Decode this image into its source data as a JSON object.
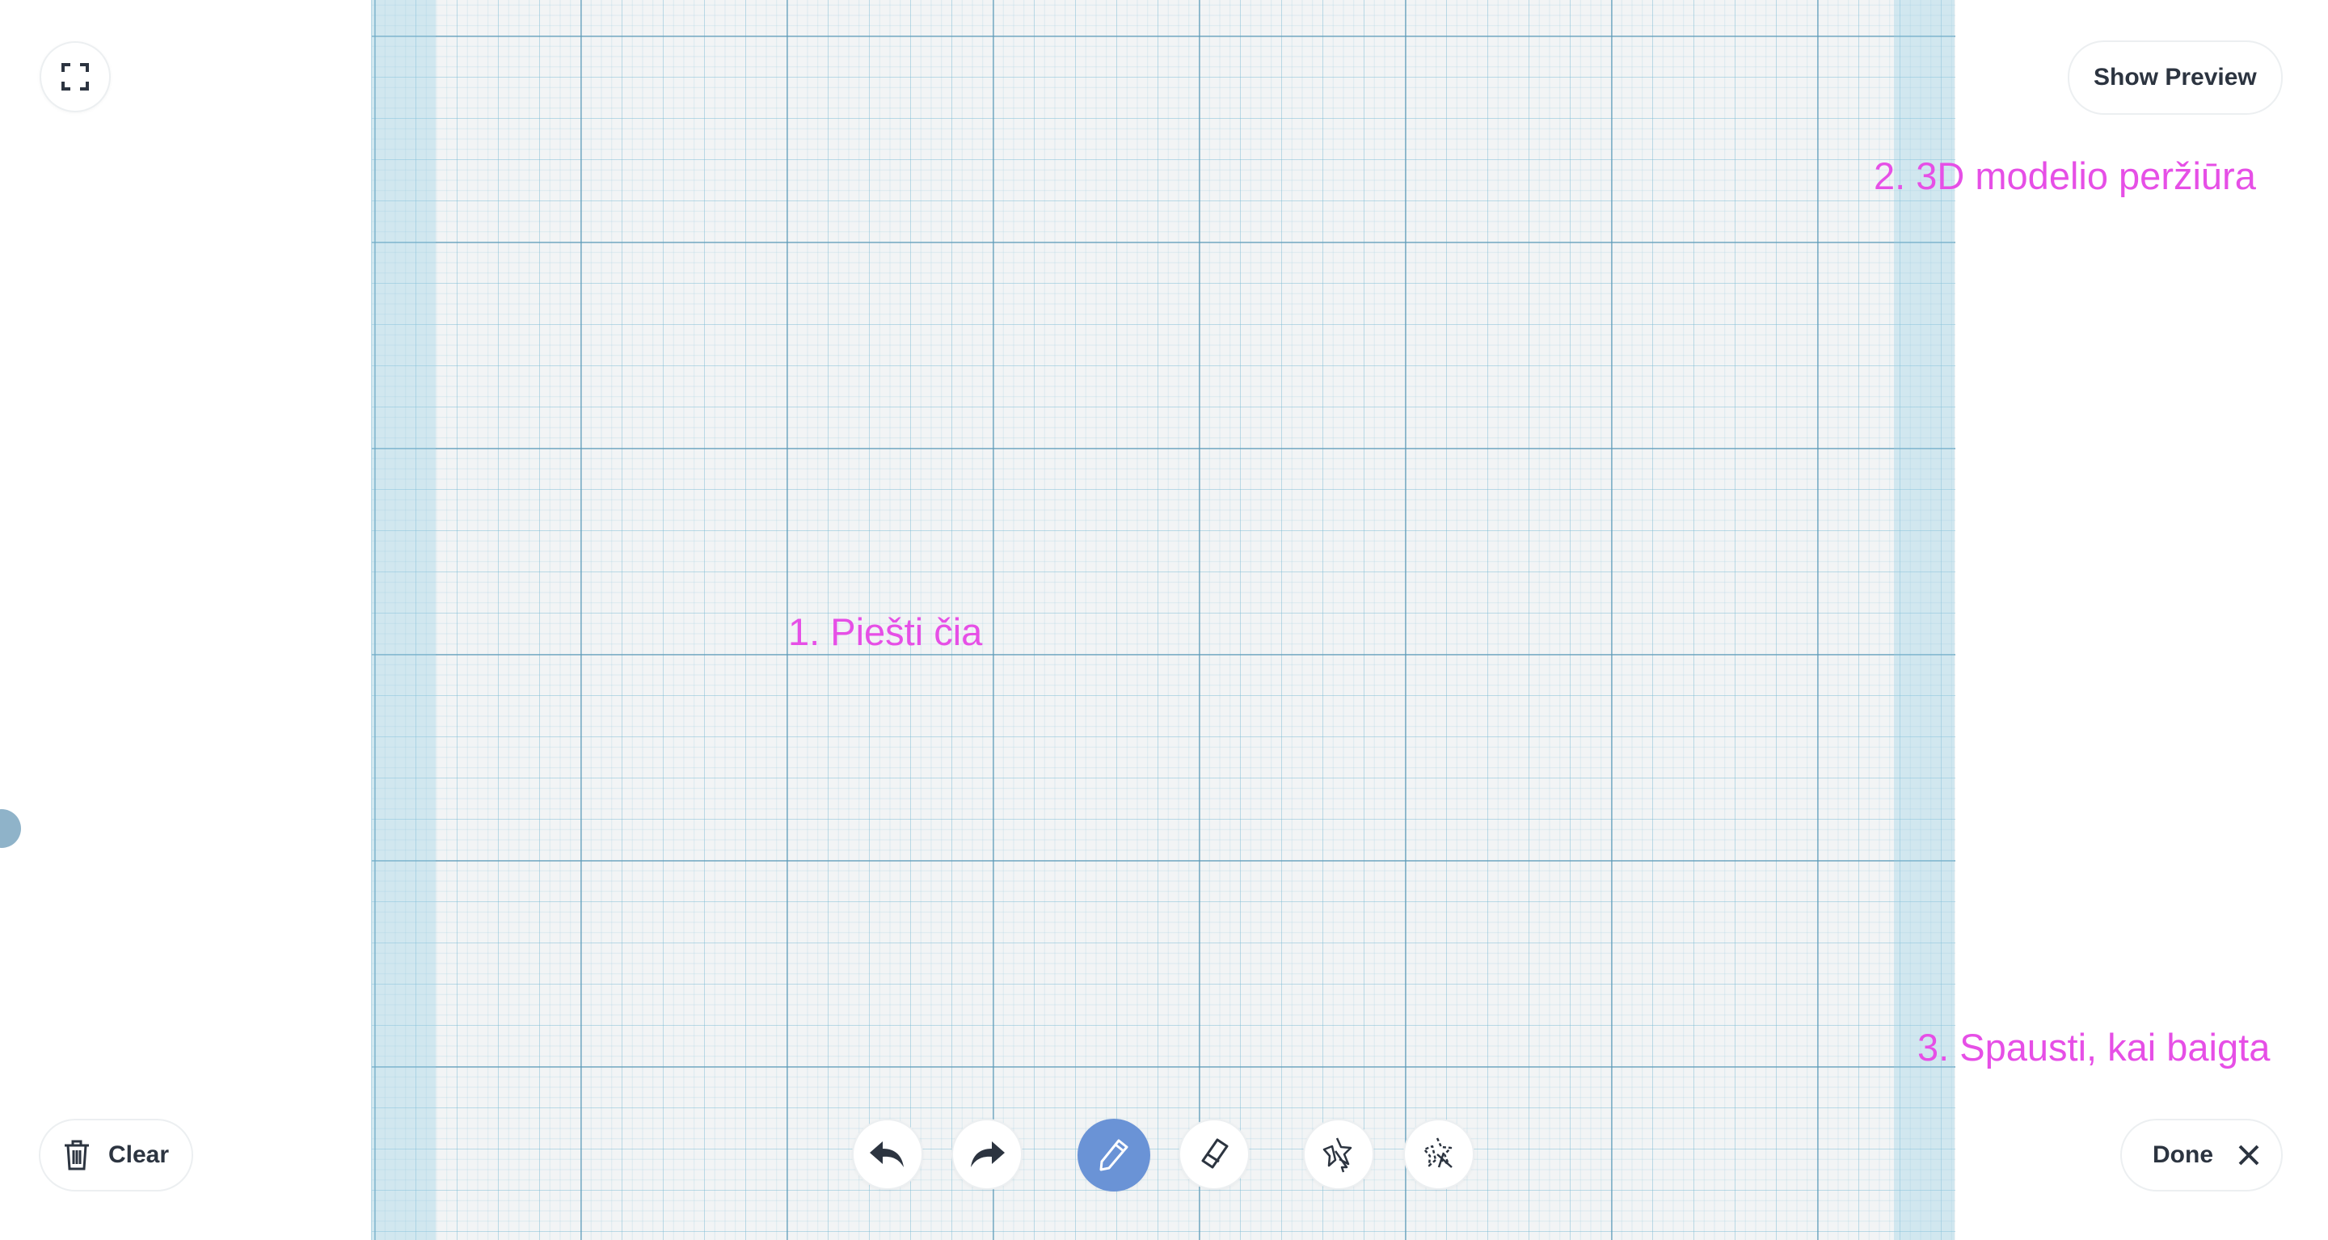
{
  "toolbar": {
    "fullscreen_icon": "fullscreen-icon",
    "show_preview_label": "Show Preview",
    "clear_label": "Clear",
    "done_label": "Done",
    "tools": [
      "undo-icon",
      "redo-icon",
      "pencil-icon",
      "eraser-icon",
      "magic-pointer-icon",
      "magic-eraser-icon"
    ],
    "active_tool": "pencil",
    "accent_color": "#6a93d6"
  },
  "annotations": {
    "draw_here": "1. Piešti čia",
    "preview_3d": "2. 3D modelio peržiūra",
    "press_when_done": "3. Spausti, kai baigta",
    "color": "#e64fe6"
  }
}
